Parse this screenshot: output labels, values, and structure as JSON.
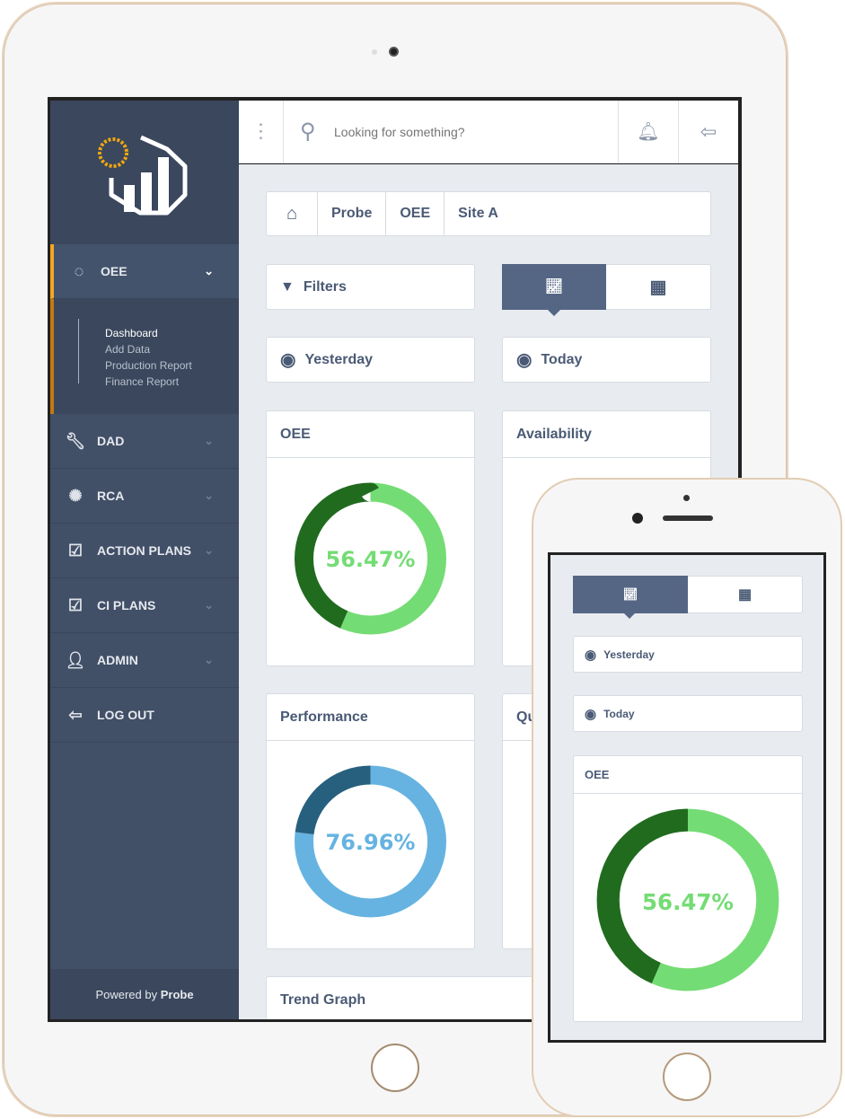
{
  "search": {
    "placeholder": "Looking for something?"
  },
  "breadcrumb": [
    "Probe",
    "OEE",
    "Site A"
  ],
  "filters_label": "Filters",
  "date_from": "Yesterday",
  "date_to": "Today",
  "sidebar": {
    "active": {
      "label": "OEE",
      "sub_items": [
        "Dashboard",
        "Add Data",
        "Production Report",
        "Finance Report"
      ],
      "selected": "Dashboard"
    },
    "items": [
      {
        "label": "DAD",
        "icon": "wrench-icon"
      },
      {
        "label": "RCA",
        "icon": "network-icon"
      },
      {
        "label": "ACTION PLANS",
        "icon": "checklist-icon"
      },
      {
        "label": "CI PLANS",
        "icon": "checklist-icon"
      },
      {
        "label": "ADMIN",
        "icon": "user-icon"
      },
      {
        "label": "LOG OUT",
        "icon": "logout-icon"
      }
    ],
    "powered_prefix": "Powered by ",
    "powered_brand": "Probe"
  },
  "cards": {
    "oee": "OEE",
    "availability": "Availability",
    "performance": "Performance",
    "quality": "Qu",
    "trend": "Trend Graph"
  },
  "colors": {
    "sidebar": "#414f67",
    "accent": "#556685",
    "oee_light": "#74dc74",
    "oee_dark": "#216b1f",
    "perf_light": "#66b3e1",
    "perf_dark": "#27607f"
  },
  "chart_data": [
    {
      "type": "pie",
      "title": "OEE",
      "label": "56.47%",
      "values": [
        56.47,
        43.53
      ]
    },
    {
      "type": "pie",
      "title": "Performance",
      "label": "76.96%",
      "values": [
        76.96,
        23.04
      ]
    }
  ]
}
